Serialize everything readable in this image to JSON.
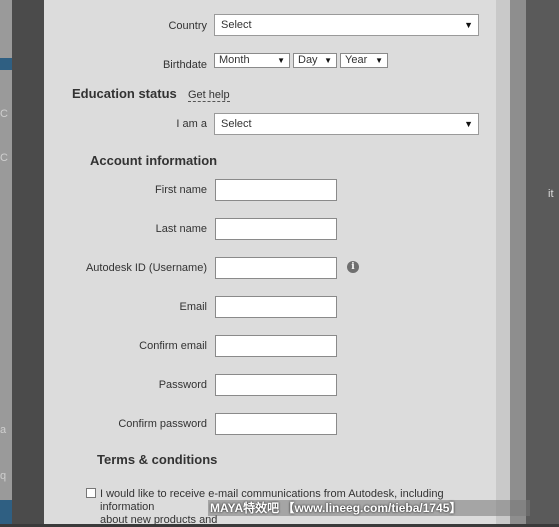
{
  "page_edges": {
    "left_chars": [
      "C",
      "C",
      "a",
      "q"
    ],
    "right_char": "it"
  },
  "form": {
    "country": {
      "label": "Country",
      "value": "Select"
    },
    "birthdate": {
      "label": "Birthdate",
      "month": "Month",
      "day": "Day",
      "year": "Year"
    },
    "education": {
      "heading": "Education status",
      "help_link": "Get help",
      "i_am_a_label": "I am a",
      "i_am_a_value": "Select"
    },
    "account": {
      "heading": "Account information",
      "first_name": "First name",
      "last_name": "Last name",
      "autodesk_id": "Autodesk ID (Username)",
      "email": "Email",
      "confirm_email": "Confirm email",
      "password": "Password",
      "confirm_password": "Confirm password"
    },
    "terms": {
      "heading": "Terms & conditions",
      "consent_line1": "I would like to receive e-mail communications from Autodesk, including information",
      "consent_line2": "about new products and"
    }
  },
  "icons": {
    "dropdown": "triangle-down",
    "info": "info-circle"
  },
  "watermark": "MAYA特效吧 【www.lineeg.com/tieba/1745】"
}
